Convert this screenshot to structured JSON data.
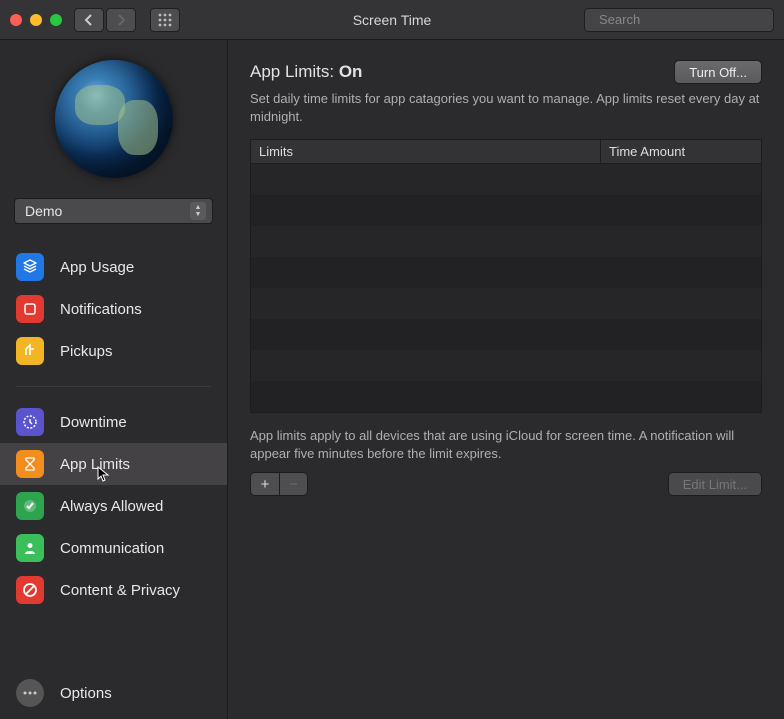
{
  "window": {
    "title": "Screen Time",
    "search_placeholder": "Search"
  },
  "account": {
    "selected": "Demo"
  },
  "sidebar": {
    "group1": [
      {
        "id": "app-usage",
        "label": "App Usage",
        "color": "blue",
        "icon": "layers-icon"
      },
      {
        "id": "notifications",
        "label": "Notifications",
        "color": "red",
        "icon": "notification-icon"
      },
      {
        "id": "pickups",
        "label": "Pickups",
        "color": "yellow",
        "icon": "pickup-icon"
      }
    ],
    "group2": [
      {
        "id": "downtime",
        "label": "Downtime",
        "color": "purple",
        "icon": "clock-icon"
      },
      {
        "id": "app-limits",
        "label": "App Limits",
        "color": "orange",
        "icon": "hourglass-icon",
        "selected": true
      },
      {
        "id": "always-allowed",
        "label": "Always Allowed",
        "color": "green",
        "icon": "check-seal-icon"
      },
      {
        "id": "communication",
        "label": "Communication",
        "color": "green2",
        "icon": "person-icon"
      },
      {
        "id": "content-privacy",
        "label": "Content & Privacy",
        "color": "red2",
        "icon": "no-symbol-icon"
      }
    ],
    "options_label": "Options"
  },
  "main": {
    "heading_prefix": "App Limits: ",
    "heading_state": "On",
    "turn_off_label": "Turn Off...",
    "description": "Set daily time limits for app catagories you want to manage. App limits reset every day at midnight.",
    "table": {
      "col_limits": "Limits",
      "col_amount": "Time Amount"
    },
    "footer_note": "App limits apply to all devices that are using iCloud for screen time. A notification will appear five minutes before the limit expires.",
    "add_symbol": "+",
    "remove_symbol": "−",
    "edit_label": "Edit Limit..."
  }
}
